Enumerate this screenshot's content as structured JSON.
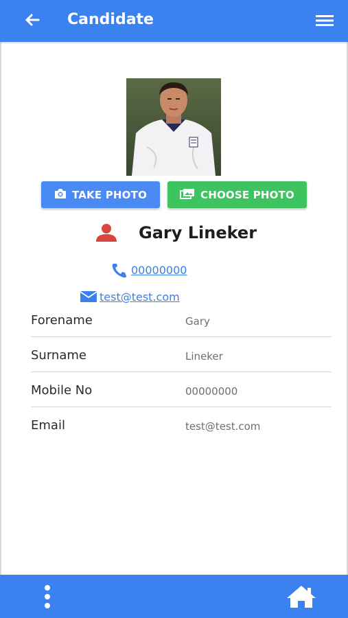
{
  "header": {
    "title": "Candidate",
    "back_icon": "arrow-left-icon",
    "menu_icon": "hamburger-menu-icon",
    "background": "#3b82f0"
  },
  "photo": {
    "alt": "Candidate photo"
  },
  "actions": {
    "take_photo_label": "TAKE PHOTO",
    "take_photo_icon": "camera-icon",
    "take_photo_color": "#4a8af4",
    "choose_photo_label": "CHOOSE PHOTO",
    "choose_photo_icon": "photo-library-icon",
    "choose_photo_color": "#3ec45e"
  },
  "candidate": {
    "full_name": "Gary Lineker",
    "person_icon": "person-icon",
    "person_icon_color": "#d9443f",
    "phone_link": " 00000000",
    "email_link": "test@test.com"
  },
  "details": [
    {
      "label": "Forename",
      "value": "Gary"
    },
    {
      "label": "Surname",
      "value": "Lineker"
    },
    {
      "label": "Mobile No",
      "value": "00000000"
    },
    {
      "label": "Email",
      "value": "test@test.com"
    }
  ],
  "footer": {
    "more_icon": "more-vertical-icon",
    "home_icon": "home-icon",
    "background": "#3b82f0"
  }
}
